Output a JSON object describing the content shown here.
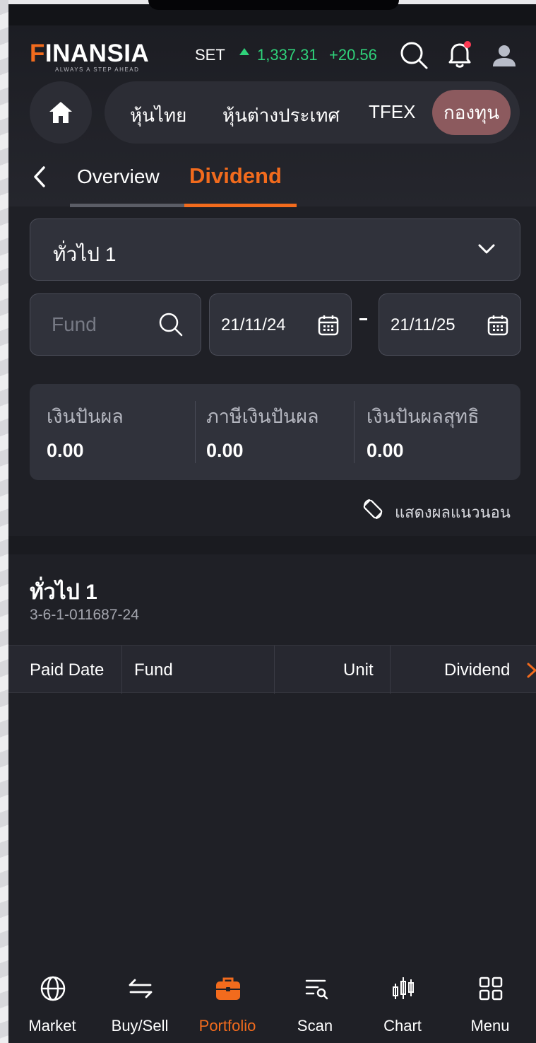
{
  "app": {
    "logo_text": "FINANSIA",
    "logo_tagline": "ALWAYS A STEP AHEAD",
    "brand_color": "#f26b1d"
  },
  "ticker": {
    "label": "SET",
    "value": "1,337.31",
    "change": "+20.56",
    "direction": "up",
    "color": "#2fd27a"
  },
  "header_icons": [
    "search-icon",
    "bell-icon",
    "user-icon"
  ],
  "nav": {
    "home_icon": "home-icon",
    "items": [
      {
        "label": "หุ้นไทย"
      },
      {
        "label": "หุ้นต่างประเทศ"
      },
      {
        "label": "TFEX"
      },
      {
        "label": "กองทุน",
        "active": true
      }
    ]
  },
  "subtabs": {
    "items": [
      {
        "label": "Overview"
      },
      {
        "label": "Dividend",
        "active": true
      }
    ]
  },
  "filters": {
    "account_selected": "ทั่วไป 1",
    "fund_placeholder": "Fund",
    "date_from": "21/11/24",
    "date_to": "21/11/25"
  },
  "summary": {
    "items": [
      {
        "label": "เงินปันผล",
        "value": "0.00"
      },
      {
        "label": "ภาษีเงินปันผล",
        "value": "0.00"
      },
      {
        "label": "เงินปันผลสุทธิ",
        "value": "0.00"
      }
    ]
  },
  "landscape_label": "แสดงผลแนวนอน",
  "account": {
    "name": "ทั่วไป 1",
    "number": "3-6-1-011687-24"
  },
  "table": {
    "columns": [
      "Paid Date",
      "Fund",
      "Unit",
      "Dividend"
    ],
    "rows": []
  },
  "bottom_nav": {
    "items": [
      {
        "label": "Market",
        "icon": "globe-icon"
      },
      {
        "label": "Buy/Sell",
        "icon": "swap-icon"
      },
      {
        "label": "Portfolio",
        "icon": "briefcase-icon",
        "active": true
      },
      {
        "label": "Scan",
        "icon": "scan-icon"
      },
      {
        "label": "Chart",
        "icon": "candlestick-icon"
      },
      {
        "label": "Menu",
        "icon": "grid-icon"
      }
    ]
  }
}
